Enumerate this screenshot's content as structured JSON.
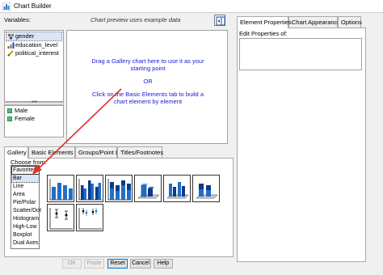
{
  "window": {
    "title": "Chart Builder"
  },
  "variables": {
    "label": "Variables:",
    "items": [
      {
        "name": "gender",
        "icon": "nominal-icon"
      },
      {
        "name": "education_level",
        "icon": "ordinal-icon"
      },
      {
        "name": "political_interest",
        "icon": "scale-icon"
      }
    ],
    "categories": [
      "Male",
      "Female"
    ]
  },
  "preview": {
    "note": "Chart preview uses example data",
    "message_line1": "Drag a Gallery chart here to use it as your",
    "message_line2": "starting point",
    "or": "OR",
    "message_line3": "Click on the Basic Elements tab to build a",
    "message_line4": "chart element by element"
  },
  "bottom_tabs": [
    "Gallery",
    "Basic Elements",
    "Groups/Point ID",
    "Titles/Footnotes"
  ],
  "gallery": {
    "choose_label": "Choose from:",
    "chart_types": [
      "Favorites",
      "Bar",
      "Line",
      "Area",
      "Pie/Polar",
      "Scatter/Dot",
      "Histogram",
      "High-Low",
      "Boxplot",
      "Dual Axes"
    ],
    "selected": "Bar"
  },
  "buttons": {
    "ok": "OK",
    "paste": "Paste",
    "reset": "Reset",
    "cancel": "Cancel",
    "help": "Help"
  },
  "right_tabs": [
    "Element Properties",
    "Chart Appearance",
    "Options"
  ],
  "right_panel": {
    "edit_label": "Edit Properties of:"
  },
  "colors": {
    "bar_blue": "#1f6fc6",
    "dark_blue": "#0b3a8a",
    "category_green": "#4fbf7a",
    "arrow_red": "#e0302a",
    "hint_blue": "#1a1ad6"
  }
}
